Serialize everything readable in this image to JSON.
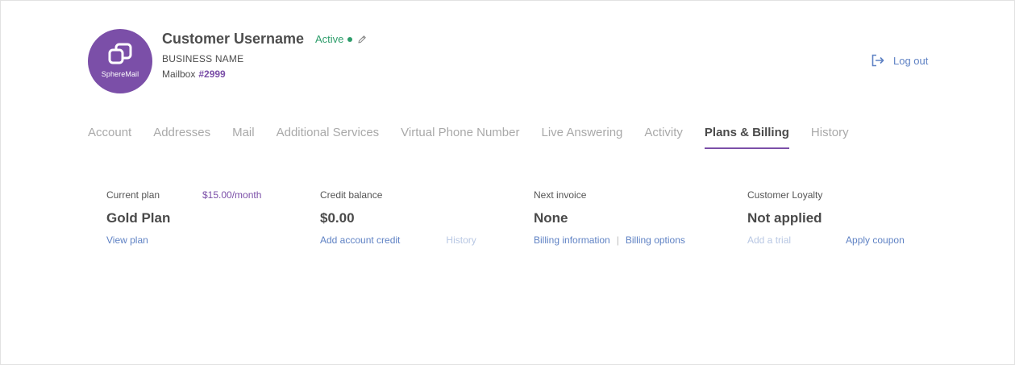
{
  "profile": {
    "username": "Customer Username",
    "status": "Active",
    "business_name": "BUSINESS NAME",
    "mailbox_label": "Mailbox",
    "mailbox_number": "#2999",
    "brand": "SphereMail"
  },
  "header": {
    "logout_label": "Log out"
  },
  "tabs": [
    {
      "label": "Account",
      "active": false
    },
    {
      "label": "Addresses",
      "active": false
    },
    {
      "label": "Mail",
      "active": false
    },
    {
      "label": "Additional Services",
      "active": false
    },
    {
      "label": "Virtual Phone Number",
      "active": false
    },
    {
      "label": "Live Answering",
      "active": false
    },
    {
      "label": "Activity",
      "active": false
    },
    {
      "label": "Plans & Billing",
      "active": true
    },
    {
      "label": "History",
      "active": false
    }
  ],
  "billing": {
    "current_plan": {
      "label": "Current plan",
      "price": "$15.00/month",
      "value": "Gold Plan",
      "link": "View plan"
    },
    "credit_balance": {
      "label": "Credit balance",
      "value": "$0.00",
      "link_add": "Add account credit",
      "link_history": "History"
    },
    "next_invoice": {
      "label": "Next invoice",
      "value": "None",
      "link_info": "Billing information",
      "link_options": "Billing options"
    },
    "loyalty": {
      "label": "Customer Loyalty",
      "value": "Not applied",
      "link_trial": "Add a trial",
      "link_coupon": "Apply coupon"
    }
  },
  "colors": {
    "accent": "#7b4fa8",
    "link": "#5f82c4",
    "status": "#2e9d6b"
  }
}
